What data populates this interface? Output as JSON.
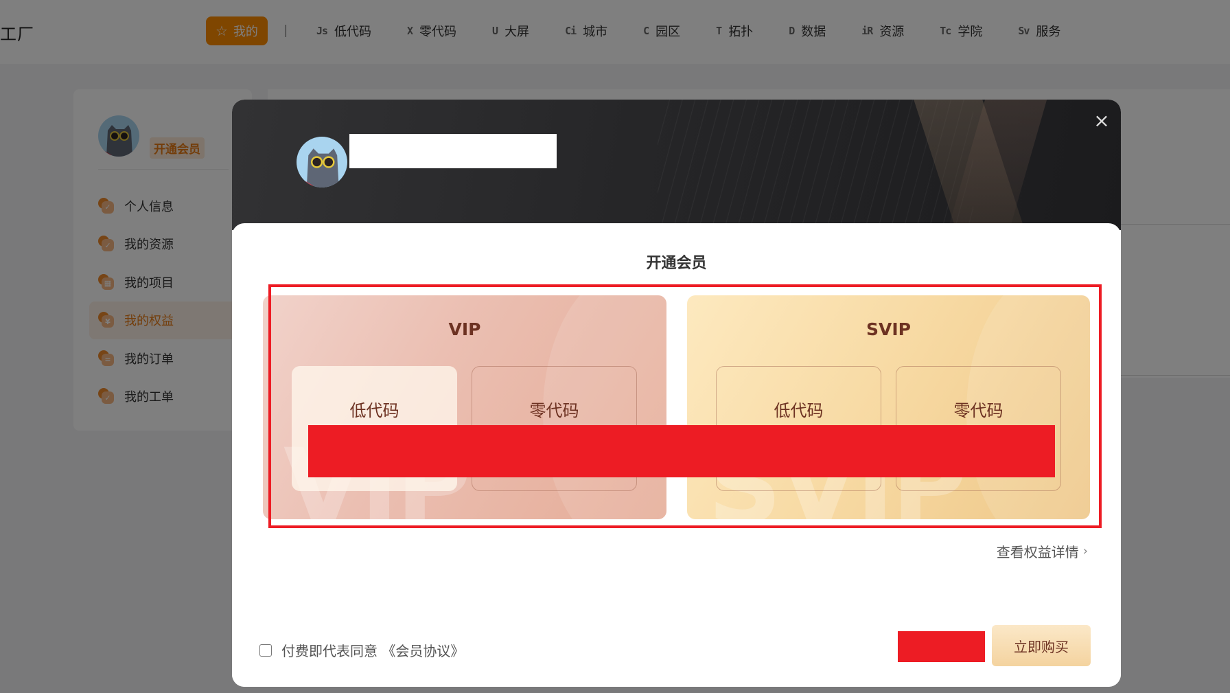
{
  "header": {
    "brand": "工厂",
    "nav_active": {
      "label": "我的",
      "icon": "star-icon"
    },
    "nav_items": [
      {
        "label": "低代码",
        "icon_text": "Js"
      },
      {
        "label": "零代码",
        "icon_text": "X"
      },
      {
        "label": "大屏",
        "icon_text": "U"
      },
      {
        "label": "城市",
        "icon_text": "Ci"
      },
      {
        "label": "园区",
        "icon_text": "C"
      },
      {
        "label": "拓扑",
        "icon_text": "T"
      },
      {
        "label": "数据",
        "icon_text": "D"
      },
      {
        "label": "资源",
        "icon_text": "iR"
      },
      {
        "label": "学院",
        "icon_text": "Tc"
      },
      {
        "label": "服务",
        "icon_text": "Sv"
      }
    ]
  },
  "sidebar": {
    "open_vip": "开通会员",
    "items": [
      {
        "label": "个人信息",
        "glyph": "✓",
        "active": false
      },
      {
        "label": "我的资源",
        "glyph": "✓",
        "active": false
      },
      {
        "label": "我的项目",
        "glyph": "▦",
        "active": false
      },
      {
        "label": "我的权益",
        "glyph": "¥",
        "active": true
      },
      {
        "label": "我的订单",
        "glyph": "=",
        "active": false
      },
      {
        "label": "我的工单",
        "glyph": "✓",
        "active": false
      }
    ]
  },
  "modal": {
    "title": "开通会员",
    "close_icon": "×",
    "plans": [
      {
        "name": "VIP",
        "watermark": "VIP",
        "options": [
          "低代码",
          "零代码"
        ],
        "selected": 0
      },
      {
        "name": "SVIP",
        "watermark": "SVIP",
        "options": [
          "低代码",
          "零代码"
        ],
        "selected": null
      }
    ],
    "details_link": "查看权益详情",
    "details_chevron": "›",
    "agreement_text": "付费即代表同意 《会员协议》",
    "agreement_checked": false,
    "buy_label": "立即购买"
  },
  "colors": {
    "accent": "#ff8c00",
    "redaction": "#ed1c24",
    "plan_text": "#6d3222"
  }
}
